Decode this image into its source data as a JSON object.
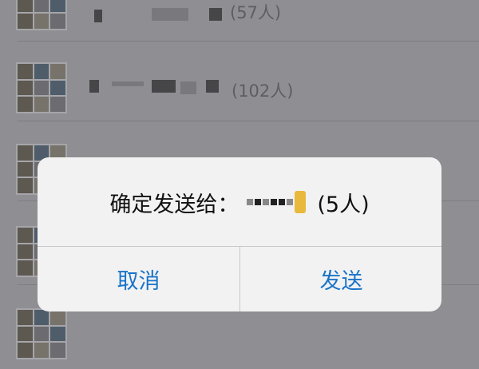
{
  "list": {
    "items": [
      {
        "count": "(57人)"
      },
      {
        "count": "(102人)"
      },
      {
        "count": ""
      },
      {
        "count": ""
      }
    ]
  },
  "dialog": {
    "message_prefix": "确定发送给：",
    "recipient_count": "(5人)",
    "cancel_label": "取消",
    "send_label": "发送"
  },
  "colors": {
    "overlay": "#8f8f93",
    "dialog_bg": "#f2f2f3",
    "button_text": "#1a74c8"
  }
}
